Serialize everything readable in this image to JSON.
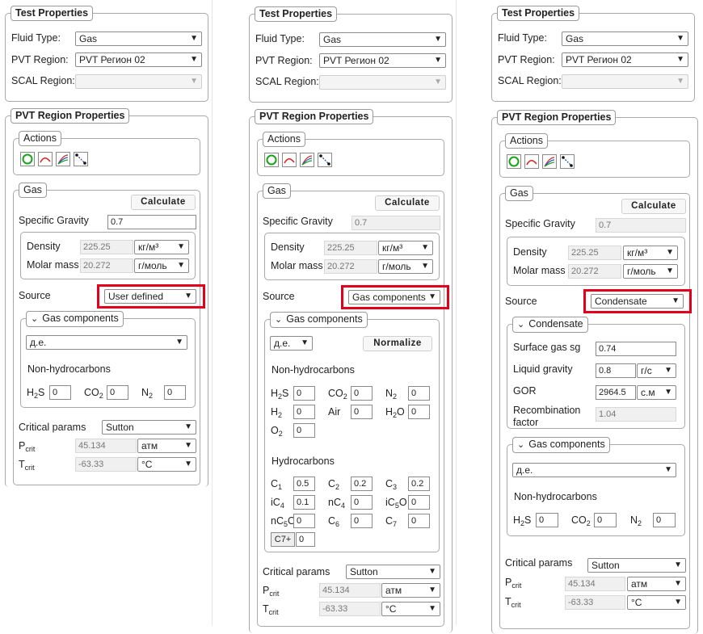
{
  "panels": [
    {
      "test_props": {
        "legend": "Test Properties",
        "fluid_label": "Fluid Type:",
        "fluid_value": "Gas",
        "pvt_label": "PVT Region:",
        "pvt_value": "PVT Регион 02",
        "scal_label": "SCAL Region:",
        "scal_value": ""
      },
      "pvt_props": {
        "legend": "PVT Region Properties",
        "actions_legend": "Actions",
        "gas_legend": "Gas",
        "calculate": "Calculate",
        "sg_label": "Specific Gravity",
        "sg_value": "0.7",
        "density_label": "Density",
        "density_value": "225.25",
        "density_unit": "кг/м³",
        "molar_label": "Molar mass",
        "molar_value": "20.272",
        "molar_unit": "г/моль",
        "source_label": "Source",
        "source_value": "User defined",
        "gc_legend": "Gas components",
        "gc_unit": "д.е.",
        "nonhc_title": "Non-hydrocarbons",
        "h2s": "0",
        "co2": "0",
        "n2": "0",
        "crit_label": "Critical params",
        "crit_value": "Sutton",
        "pcrit_value": "45.134",
        "pcrit_unit": "атм",
        "tcrit_value": "-63.33",
        "tcrit_unit": "°C"
      }
    },
    {
      "test_props": {
        "legend": "Test Properties",
        "fluid_label": "Fluid Type:",
        "fluid_value": "Gas",
        "pvt_label": "PVT Region:",
        "pvt_value": "PVT Регион 02",
        "scal_label": "SCAL Region:",
        "scal_value": ""
      },
      "pvt_props": {
        "legend": "PVT Region Properties",
        "actions_legend": "Actions",
        "gas_legend": "Gas",
        "calculate": "Calculate",
        "sg_label": "Specific Gravity",
        "sg_value": "0.7",
        "density_label": "Density",
        "density_value": "225.25",
        "density_unit": "кг/м³",
        "molar_label": "Molar mass",
        "molar_value": "20.272",
        "molar_unit": "г/моль",
        "source_label": "Source",
        "source_value": "Gas components",
        "gc_legend": "Gas components",
        "gc_unit": "д.е.",
        "normalize": "Normalize",
        "nonhc_title": "Non-hydrocarbons",
        "h2s": "0",
        "co2": "0",
        "n2": "0",
        "h2": "0",
        "air_label": "Air",
        "air": "0",
        "h2o": "0",
        "o2": "0",
        "hc_title": "Hydrocarbons",
        "c1": "0.5",
        "c2": "0.2",
        "c3": "0.2",
        "ic4": "0.1",
        "nc4": "0",
        "ic5": "0",
        "nc5": "0",
        "c6": "0",
        "c7": "0",
        "c7plus_label": "C7+",
        "c7plus": "0",
        "crit_label": "Critical params",
        "crit_value": "Sutton",
        "pcrit_value": "45.134",
        "pcrit_unit": "атм",
        "tcrit_value": "-63.33",
        "tcrit_unit": "°C"
      }
    },
    {
      "test_props": {
        "legend": "Test Properties",
        "fluid_label": "Fluid Type:",
        "fluid_value": "Gas",
        "pvt_label": "PVT Region:",
        "pvt_value": "PVT Регион 02",
        "scal_label": "SCAL Region:",
        "scal_value": ""
      },
      "pvt_props": {
        "legend": "PVT Region Properties",
        "actions_legend": "Actions",
        "gas_legend": "Gas",
        "calculate": "Calculate",
        "sg_label": "Specific Gravity",
        "sg_value": "0.7",
        "density_label": "Density",
        "density_value": "225.25",
        "density_unit": "кг/м³",
        "molar_label": "Molar mass",
        "molar_value": "20.272",
        "molar_unit": "г/моль",
        "source_label": "Source",
        "source_value": "Condensate",
        "cond_legend": "Condensate",
        "surf_label": "Surface gas sg",
        "surf_value": "0.74",
        "liq_label": "Liquid gravity",
        "liq_value": "0.8",
        "liq_unit": "г/с",
        "gor_label": "GOR",
        "gor_value": "2964.5",
        "gor_unit": "с.м",
        "recomb_label": "Recombination factor",
        "recomb_value": "1.04",
        "gc_legend": "Gas components",
        "gc_unit": "д.е.",
        "nonhc_title": "Non-hydrocarbons",
        "h2s": "0",
        "co2": "0",
        "n2": "0",
        "crit_label": "Critical params",
        "crit_value": "Sutton",
        "pcrit_value": "45.134",
        "pcrit_unit": "атм",
        "tcrit_value": "-63.33",
        "tcrit_unit": "°C"
      }
    }
  ],
  "icons": [
    "refresh-icon",
    "curve-icon",
    "multi-curve-icon",
    "points-icon"
  ],
  "colors": {
    "highlight": "#e2001a",
    "refresh": "#1aa31a",
    "curve": "#d42020"
  }
}
